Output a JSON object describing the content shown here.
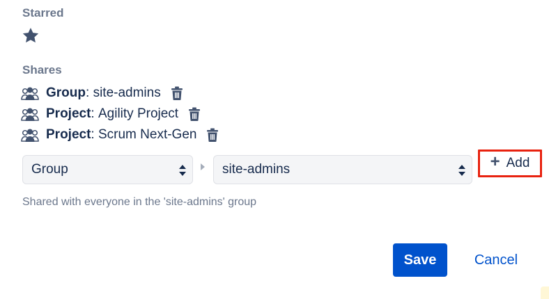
{
  "starred": {
    "label": "Starred",
    "icon": "star-icon"
  },
  "shares": {
    "label": "Shares",
    "items": [
      {
        "type": "Group",
        "separator": ":",
        "name": "site-admins"
      },
      {
        "type": "Project",
        "separator": ":",
        "name": "Agility Project"
      },
      {
        "type": "Project",
        "separator": ":",
        "name": "Scrum Next-Gen"
      }
    ]
  },
  "share_form": {
    "type_select": {
      "value": "Group"
    },
    "target_select": {
      "value": "site-admins"
    },
    "add_button": {
      "label": "Add",
      "icon": "plus-icon"
    },
    "help_text": "Shared with everyone in the 'site-admins' group"
  },
  "footer": {
    "save_label": "Save",
    "cancel_label": "Cancel"
  },
  "colors": {
    "primary": "#0052CC",
    "text": "#172B4D",
    "muted": "#6B778C",
    "highlight": "#E8220F"
  }
}
